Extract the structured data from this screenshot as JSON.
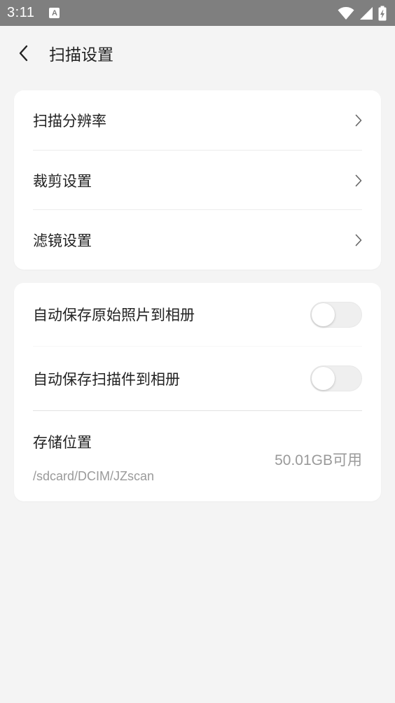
{
  "status_bar": {
    "time": "3:11",
    "notification_icon": "a-icon",
    "right_icons": [
      "wifi-icon",
      "signal-icon",
      "battery-charging-icon"
    ]
  },
  "app_bar": {
    "back_icon": "back-arrow-icon",
    "title": "扫描设置"
  },
  "settings_group_1": {
    "items": [
      {
        "label": "扫描分辨率",
        "icon": "chevron-right-icon"
      },
      {
        "label": "裁剪设置",
        "icon": "chevron-right-icon"
      },
      {
        "label": "滤镜设置",
        "icon": "chevron-right-icon"
      }
    ]
  },
  "settings_group_2": {
    "toggles": [
      {
        "label": "自动保存原始照片到相册",
        "checked": false
      },
      {
        "label": "自动保存扫描件到相册",
        "checked": false
      }
    ],
    "storage": {
      "title": "存储位置",
      "path": "/sdcard/DCIM/JZscan",
      "free_space": "50.01GB可用"
    }
  },
  "colors": {
    "background": "#f4f4f4",
    "card": "#ffffff",
    "status_bar": "#7f7f7f",
    "text_primary": "#222222",
    "text_secondary": "#9a9a9a"
  }
}
